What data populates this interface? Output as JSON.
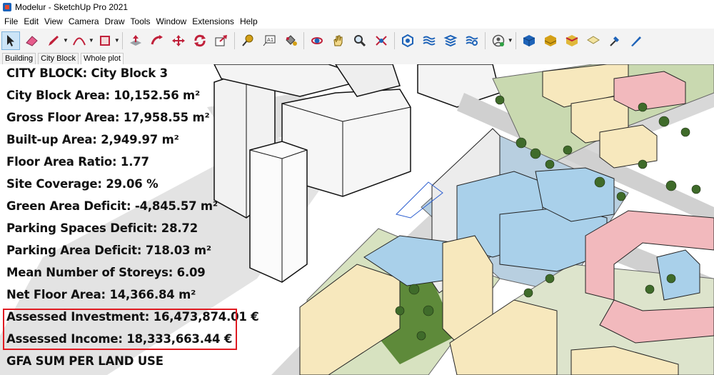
{
  "window": {
    "title": "Modelur - SketchUp Pro 2021"
  },
  "menu": [
    "File",
    "Edit",
    "View",
    "Camera",
    "Draw",
    "Tools",
    "Window",
    "Extensions",
    "Help"
  ],
  "toolbar": {
    "tools": [
      {
        "name": "select-tool-icon",
        "color": "#222222"
      },
      {
        "name": "eraser-tool-icon",
        "color": "#e65c8c"
      },
      {
        "name": "pencil-line-tool-icon",
        "color": "#c0203a"
      },
      {
        "name": "arc-tool-icon",
        "color": "#c0203a"
      },
      {
        "name": "rectangle-tool-icon",
        "color": "#c0203a"
      },
      {
        "name": "push-pull-tool-icon",
        "color": "#c0203a"
      },
      {
        "name": "follow-me-tool-icon",
        "color": "#c0203a"
      },
      {
        "name": "move-tool-icon",
        "color": "#c0203a"
      },
      {
        "name": "rotate-tool-icon",
        "color": "#c0203a"
      },
      {
        "name": "scale-tool-icon",
        "color": "#c0203a"
      },
      {
        "name": "tape-measure-tool-icon",
        "color": "#d4a017"
      },
      {
        "name": "text-tool-icon",
        "color": "#333333"
      },
      {
        "name": "paint-bucket-tool-icon",
        "color": "#d4a017"
      },
      {
        "name": "orbit-tool-icon",
        "color": "#c0203a"
      },
      {
        "name": "pan-tool-icon",
        "color": "#d4a017"
      },
      {
        "name": "zoom-tool-icon",
        "color": "#1e63b8"
      },
      {
        "name": "zoom-extents-tool-icon",
        "color": "#1e63b8"
      },
      {
        "name": "modelur-generate-icon",
        "color": "#1e63b8"
      },
      {
        "name": "modelur-layers-icon",
        "color": "#1e63b8"
      },
      {
        "name": "modelur-stack-icon",
        "color": "#1e63b8"
      },
      {
        "name": "modelur-settings-icon",
        "color": "#1e63b8"
      },
      {
        "name": "user-account-icon",
        "color": "#555555"
      },
      {
        "name": "sandbox-from-contours-icon",
        "color": "#1e63b8"
      },
      {
        "name": "sandbox-from-scratch-icon",
        "color": "#d4a017"
      },
      {
        "name": "smoove-icon",
        "color": "#d4a017"
      },
      {
        "name": "stamp-icon",
        "color": "#e5d26b"
      },
      {
        "name": "drape-icon",
        "color": "#1e63b8"
      },
      {
        "name": "add-detail-icon",
        "color": "#1e63b8"
      }
    ]
  },
  "scenes": {
    "tabs": [
      "Building",
      "City Block",
      "Whole plot"
    ],
    "active": "Whole plot"
  },
  "info": {
    "city_block": "CITY BLOCK: City Block 3",
    "city_block_area": "City Block Area: 10,152.56 m²",
    "gross_floor_area": "Gross Floor Area: 17,958.55 m²",
    "built_up_area": "Built-up Area: 2,949.97 m²",
    "floor_area_ratio": "Floor Area Ratio: 1.77",
    "site_coverage": "Site Coverage: 29.06 %",
    "green_area_deficit": "Green Area Deficit: -4,845.57 m²",
    "parking_spaces_deficit": "Parking Spaces Deficit: 28.72",
    "parking_area_deficit": "Parking Area Deficit: 718.03 m²",
    "mean_storeys": "Mean Number of Storeys: 6.09",
    "net_floor_area": "Net Floor Area: 14,366.84 m²",
    "assessed_investment": "Assessed Investment: 16,473,874.01 €",
    "assessed_income": "Assessed Income: 18,333,663.44 €",
    "gfa_sum": "GFA SUM PER LAND USE"
  },
  "colors": {
    "highlight": "#e01b22",
    "residential_building": "#f7e8bd",
    "commercial_building": "#f2b9bd",
    "office_building": "#a9d0ea",
    "green_area": "#5e8a3a",
    "road": "#d8d8d8"
  }
}
